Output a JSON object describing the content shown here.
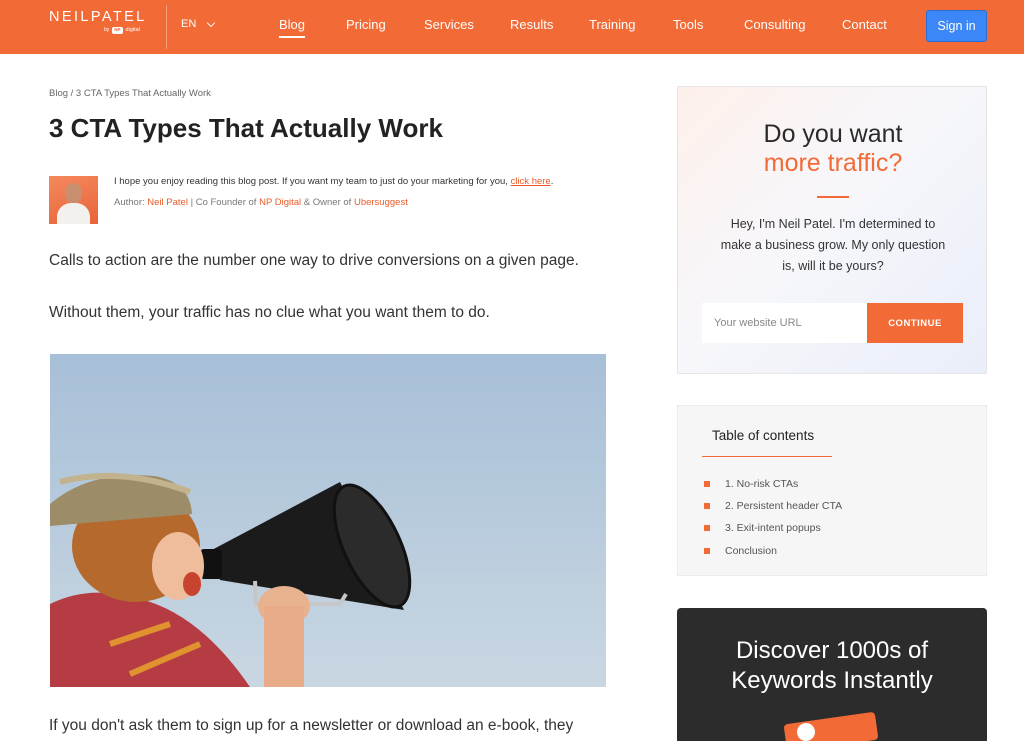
{
  "header": {
    "logo": {
      "main": "NEILPATEL",
      "by": "by",
      "badge": "NP",
      "digital": "digital"
    },
    "language": "EN",
    "nav": [
      {
        "label": "Blog",
        "active": true
      },
      {
        "label": "Pricing"
      },
      {
        "label": "Services"
      },
      {
        "label": "Results"
      },
      {
        "label": "Training"
      },
      {
        "label": "Tools"
      },
      {
        "label": "Consulting"
      },
      {
        "label": "Contact"
      }
    ],
    "signin_label": "Sign in"
  },
  "article": {
    "breadcrumb": "Blog / 3 CTA Types That Actually Work",
    "title": "3 CTA Types That Actually Work",
    "intro_text": "I hope you enjoy reading this blog post. If you want my team to just do your marketing for you,",
    "intro_link": "click here",
    "intro_end": ".",
    "byline": {
      "prefix": "Author:",
      "author": "Neil Patel",
      "sep": "|",
      "role": "Co Founder of",
      "company": "NP Digital",
      "and": "& Owner of",
      "product": "Ubersuggest"
    },
    "paragraphs": [
      "Calls to action are the number one way to drive conversions on a given page.",
      "Without them, your traffic has no clue what you want them to do.",
      "If you don't ask them to sign up for a newsletter or download an e-book, they"
    ]
  },
  "sidebar": {
    "cta": {
      "title_line1": "Do you want",
      "title_line2": "more traffic?",
      "desc_lines": [
        "Hey, I'm Neil Patel. I'm determined to",
        "make a business grow. My only question",
        "is, will it be yours?"
      ],
      "input_placeholder": "Your website URL",
      "button_label": "CONTINUE"
    },
    "toc": {
      "title": "Table of contents",
      "items": [
        "1. No-risk CTAs",
        "2. Persistent header CTA",
        "3. Exit-intent popups",
        "Conclusion"
      ]
    },
    "keywords": {
      "line1": "Discover 1000s of",
      "line2": "Keywords Instantly"
    }
  },
  "colors": {
    "brand": "#f26a36",
    "signin": "#3b87f7",
    "link": "#e85c2a"
  }
}
